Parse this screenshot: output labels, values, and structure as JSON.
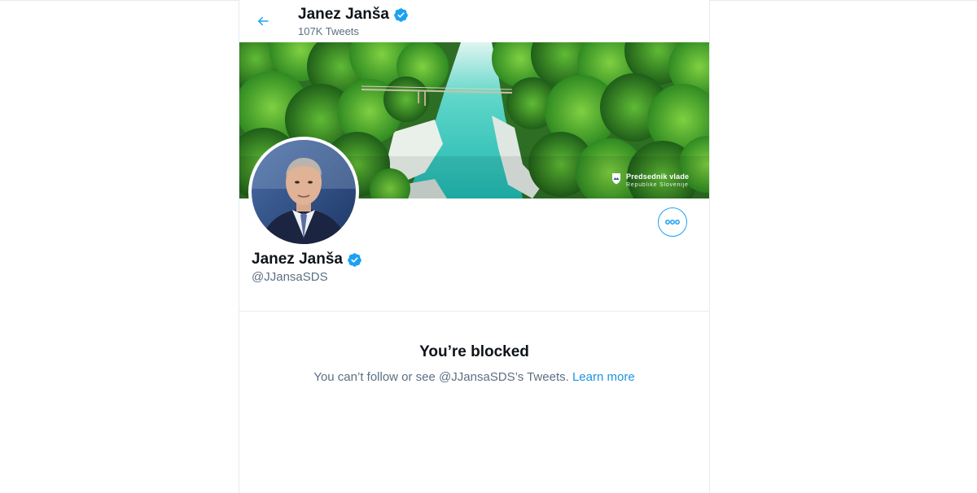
{
  "header": {
    "display_name": "Janez Janša",
    "tweet_count": "107K Tweets"
  },
  "banner": {
    "watermark_title": "Predsednik vlade",
    "watermark_subtitle": "Republike Slovenije"
  },
  "profile": {
    "display_name": "Janez Janša",
    "handle": "@JJansaSDS"
  },
  "blocked": {
    "title": "You’re blocked",
    "message": "You can’t follow or see @JJansaSDS’s Tweets. ",
    "link": "Learn more"
  },
  "icons": {
    "back": "arrow-left-icon",
    "verified": "verified-badge-icon",
    "more": "more-dots-icon",
    "crest": "slovenia-crest-icon"
  },
  "colors": {
    "accent": "#1da1f2",
    "link": "#1b95e0",
    "secondary_text": "#5b7083",
    "border": "#e6ecf0"
  }
}
